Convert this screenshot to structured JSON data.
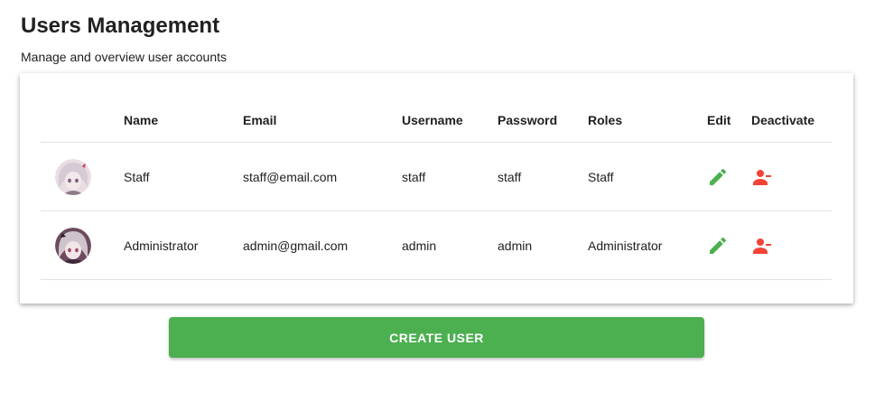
{
  "header": {
    "title": "Users Management",
    "subtitle": "Manage and overview user accounts"
  },
  "table": {
    "columns": {
      "avatar": "",
      "name": "Name",
      "email": "Email",
      "username": "Username",
      "password": "Password",
      "roles": "Roles",
      "edit": "Edit",
      "deactivate": "Deactivate"
    },
    "rows": [
      {
        "name": "Staff",
        "email": "staff@email.com",
        "username": "staff",
        "password": "staff",
        "roles": "Staff"
      },
      {
        "name": "Administrator",
        "email": "admin@gmail.com",
        "username": "admin",
        "password": "admin",
        "roles": "Administrator"
      }
    ]
  },
  "actions": {
    "create_label": "Create User"
  },
  "colors": {
    "edit_icon": "#4caf50",
    "deactivate_icon": "#f44336",
    "create_button": "#4caf50"
  },
  "icons": {
    "edit": "pencil-icon",
    "deactivate": "person-remove-icon"
  }
}
